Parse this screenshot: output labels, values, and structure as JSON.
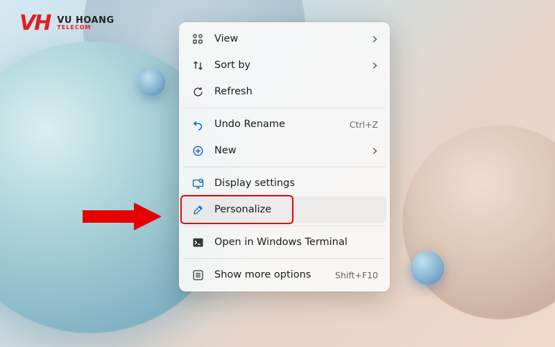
{
  "logo": {
    "mark": "VH",
    "brand": "VU HOANG",
    "sub": "TELECOM"
  },
  "menu": {
    "items": [
      {
        "icon": "grid",
        "label": "View",
        "submenu": true
      },
      {
        "icon": "sort",
        "label": "Sort by",
        "submenu": true
      },
      {
        "icon": "refresh",
        "label": "Refresh"
      },
      {
        "divider": true
      },
      {
        "icon": "undo",
        "label": "Undo Rename",
        "shortcut": "Ctrl+Z"
      },
      {
        "icon": "new",
        "label": "New",
        "submenu": true
      },
      {
        "divider": true
      },
      {
        "icon": "display",
        "label": "Display settings"
      },
      {
        "icon": "personalize",
        "label": "Personalize",
        "hovered": true,
        "highlighted": true
      },
      {
        "divider": true
      },
      {
        "icon": "terminal",
        "label": "Open in Windows Terminal"
      },
      {
        "divider": true
      },
      {
        "icon": "more",
        "label": "Show more options",
        "shortcut": "Shift+F10"
      }
    ]
  }
}
